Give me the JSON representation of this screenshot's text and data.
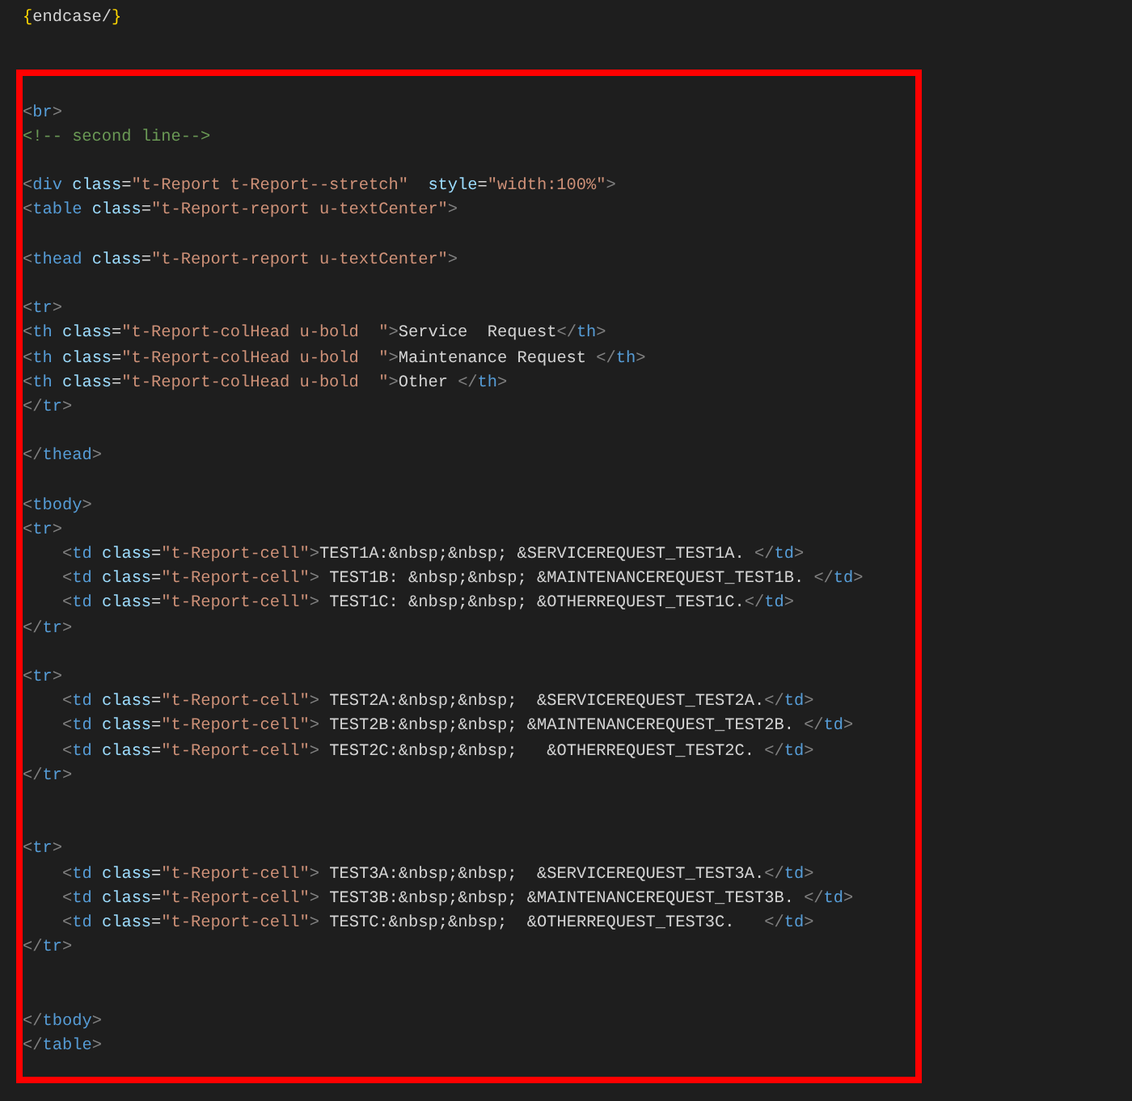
{
  "top_line": [
    {
      "kind": "brace",
      "text": "{"
    },
    {
      "kind": "text",
      "text": "endcase/"
    },
    {
      "kind": "brace",
      "text": "}"
    }
  ],
  "highlighted_code": {
    "lines": [
      {
        "kind": "code",
        "indented": false,
        "tokens": [
          {
            "kind": "punct",
            "text": "<"
          },
          {
            "kind": "tag",
            "text": "br"
          },
          {
            "kind": "punct",
            "text": ">"
          }
        ]
      },
      {
        "kind": "code",
        "indented": false,
        "tokens": [
          {
            "kind": "comment",
            "text": "<!-- second line-->"
          }
        ]
      },
      {
        "kind": "blank"
      },
      {
        "kind": "code",
        "indented": false,
        "tokens": [
          {
            "kind": "punct",
            "text": "<"
          },
          {
            "kind": "tag",
            "text": "div"
          },
          {
            "kind": "attr",
            "text": " class"
          },
          {
            "kind": "eq",
            "text": "="
          },
          {
            "kind": "string",
            "text": "\"t-Report t-Report--stretch\""
          },
          {
            "kind": "attr",
            "text": "  style"
          },
          {
            "kind": "eq",
            "text": "="
          },
          {
            "kind": "string",
            "text": "\"width:100%\""
          },
          {
            "kind": "punct",
            "text": ">"
          }
        ]
      },
      {
        "kind": "code",
        "indented": false,
        "tokens": [
          {
            "kind": "punct",
            "text": "<"
          },
          {
            "kind": "tag",
            "text": "table"
          },
          {
            "kind": "attr",
            "text": " class"
          },
          {
            "kind": "eq",
            "text": "="
          },
          {
            "kind": "string",
            "text": "\"t-Report-report u-textCenter\""
          },
          {
            "kind": "punct",
            "text": ">"
          }
        ]
      },
      {
        "kind": "blank"
      },
      {
        "kind": "code",
        "indented": false,
        "tokens": [
          {
            "kind": "punct",
            "text": "<"
          },
          {
            "kind": "tag",
            "text": "thead"
          },
          {
            "kind": "attr",
            "text": " class"
          },
          {
            "kind": "eq",
            "text": "="
          },
          {
            "kind": "string",
            "text": "\"t-Report-report u-textCenter\""
          },
          {
            "kind": "punct",
            "text": ">"
          }
        ]
      },
      {
        "kind": "blank"
      },
      {
        "kind": "code",
        "indented": false,
        "tokens": [
          {
            "kind": "punct",
            "text": "<"
          },
          {
            "kind": "tag",
            "text": "tr"
          },
          {
            "kind": "punct",
            "text": ">"
          }
        ]
      },
      {
        "kind": "code",
        "indented": false,
        "tokens": [
          {
            "kind": "punct",
            "text": "<"
          },
          {
            "kind": "tag",
            "text": "th"
          },
          {
            "kind": "attr",
            "text": " class"
          },
          {
            "kind": "eq",
            "text": "="
          },
          {
            "kind": "string",
            "text": "\"t-Report-colHead u-bold  \""
          },
          {
            "kind": "punct",
            "text": ">"
          },
          {
            "kind": "text",
            "text": "Service  Request"
          },
          {
            "kind": "punct",
            "text": "</"
          },
          {
            "kind": "tag",
            "text": "th"
          },
          {
            "kind": "punct",
            "text": ">"
          }
        ]
      },
      {
        "kind": "code",
        "indented": false,
        "tokens": [
          {
            "kind": "punct",
            "text": "<"
          },
          {
            "kind": "tag",
            "text": "th"
          },
          {
            "kind": "attr",
            "text": " class"
          },
          {
            "kind": "eq",
            "text": "="
          },
          {
            "kind": "string",
            "text": "\"t-Report-colHead u-bold  \""
          },
          {
            "kind": "punct",
            "text": ">"
          },
          {
            "kind": "text",
            "text": "Maintenance Request "
          },
          {
            "kind": "punct",
            "text": "</"
          },
          {
            "kind": "tag",
            "text": "th"
          },
          {
            "kind": "punct",
            "text": ">"
          }
        ]
      },
      {
        "kind": "code",
        "indented": false,
        "tokens": [
          {
            "kind": "punct",
            "text": "<"
          },
          {
            "kind": "tag",
            "text": "th"
          },
          {
            "kind": "attr",
            "text": " class"
          },
          {
            "kind": "eq",
            "text": "="
          },
          {
            "kind": "string",
            "text": "\"t-Report-colHead u-bold  \""
          },
          {
            "kind": "punct",
            "text": ">"
          },
          {
            "kind": "text",
            "text": "Other "
          },
          {
            "kind": "punct",
            "text": "</"
          },
          {
            "kind": "tag",
            "text": "th"
          },
          {
            "kind": "punct",
            "text": ">"
          }
        ]
      },
      {
        "kind": "code",
        "indented": false,
        "tokens": [
          {
            "kind": "punct",
            "text": "</"
          },
          {
            "kind": "tag",
            "text": "tr"
          },
          {
            "kind": "punct",
            "text": ">"
          }
        ]
      },
      {
        "kind": "blank"
      },
      {
        "kind": "code",
        "indented": false,
        "tokens": [
          {
            "kind": "punct",
            "text": "</"
          },
          {
            "kind": "tag",
            "text": "thead"
          },
          {
            "kind": "punct",
            "text": ">"
          }
        ]
      },
      {
        "kind": "blank"
      },
      {
        "kind": "code",
        "indented": false,
        "tokens": [
          {
            "kind": "punct",
            "text": "<"
          },
          {
            "kind": "tag",
            "text": "tbody"
          },
          {
            "kind": "punct",
            "text": ">"
          }
        ]
      },
      {
        "kind": "code",
        "indented": false,
        "tokens": [
          {
            "kind": "punct",
            "text": "<"
          },
          {
            "kind": "tag",
            "text": "tr"
          },
          {
            "kind": "punct",
            "text": ">"
          }
        ]
      },
      {
        "kind": "code",
        "indented": true,
        "tokens": [
          {
            "kind": "punct",
            "text": "<"
          },
          {
            "kind": "tag",
            "text": "td"
          },
          {
            "kind": "attr",
            "text": " class"
          },
          {
            "kind": "eq",
            "text": "="
          },
          {
            "kind": "string",
            "text": "\"t-Report-cell\""
          },
          {
            "kind": "punct",
            "text": ">"
          },
          {
            "kind": "text",
            "text": "TEST1A:&nbsp;&nbsp; &SERVICEREQUEST_TEST1A. "
          },
          {
            "kind": "punct",
            "text": "</"
          },
          {
            "kind": "tag",
            "text": "td"
          },
          {
            "kind": "punct",
            "text": ">"
          }
        ]
      },
      {
        "kind": "code",
        "indented": true,
        "tokens": [
          {
            "kind": "punct",
            "text": "<"
          },
          {
            "kind": "tag",
            "text": "td"
          },
          {
            "kind": "attr",
            "text": " class"
          },
          {
            "kind": "eq",
            "text": "="
          },
          {
            "kind": "string",
            "text": "\"t-Report-cell\""
          },
          {
            "kind": "punct",
            "text": ">"
          },
          {
            "kind": "text",
            "text": " TEST1B: &nbsp;&nbsp; &MAINTENANCEREQUEST_TEST1B. "
          },
          {
            "kind": "punct",
            "text": "</"
          },
          {
            "kind": "tag",
            "text": "td"
          },
          {
            "kind": "punct",
            "text": ">"
          }
        ]
      },
      {
        "kind": "code",
        "indented": true,
        "tokens": [
          {
            "kind": "punct",
            "text": "<"
          },
          {
            "kind": "tag",
            "text": "td"
          },
          {
            "kind": "attr",
            "text": " class"
          },
          {
            "kind": "eq",
            "text": "="
          },
          {
            "kind": "string",
            "text": "\"t-Report-cell\""
          },
          {
            "kind": "punct",
            "text": ">"
          },
          {
            "kind": "text",
            "text": " TEST1C: &nbsp;&nbsp; &OTHERREQUEST_TEST1C."
          },
          {
            "kind": "punct",
            "text": "</"
          },
          {
            "kind": "tag",
            "text": "td"
          },
          {
            "kind": "punct",
            "text": ">"
          }
        ]
      },
      {
        "kind": "code",
        "indented": false,
        "tokens": [
          {
            "kind": "punct",
            "text": "</"
          },
          {
            "kind": "tag",
            "text": "tr"
          },
          {
            "kind": "punct",
            "text": ">"
          }
        ]
      },
      {
        "kind": "blank"
      },
      {
        "kind": "code",
        "indented": false,
        "tokens": [
          {
            "kind": "punct",
            "text": "<"
          },
          {
            "kind": "tag",
            "text": "tr"
          },
          {
            "kind": "punct",
            "text": ">"
          }
        ]
      },
      {
        "kind": "code",
        "indented": true,
        "tokens": [
          {
            "kind": "punct",
            "text": "<"
          },
          {
            "kind": "tag",
            "text": "td"
          },
          {
            "kind": "attr",
            "text": " class"
          },
          {
            "kind": "eq",
            "text": "="
          },
          {
            "kind": "string",
            "text": "\"t-Report-cell\""
          },
          {
            "kind": "punct",
            "text": ">"
          },
          {
            "kind": "text",
            "text": " TEST2A:&nbsp;&nbsp;  &SERVICEREQUEST_TEST2A."
          },
          {
            "kind": "punct",
            "text": "</"
          },
          {
            "kind": "tag",
            "text": "td"
          },
          {
            "kind": "punct",
            "text": ">"
          }
        ]
      },
      {
        "kind": "code",
        "indented": true,
        "tokens": [
          {
            "kind": "punct",
            "text": "<"
          },
          {
            "kind": "tag",
            "text": "td"
          },
          {
            "kind": "attr",
            "text": " class"
          },
          {
            "kind": "eq",
            "text": "="
          },
          {
            "kind": "string",
            "text": "\"t-Report-cell\""
          },
          {
            "kind": "punct",
            "text": ">"
          },
          {
            "kind": "text",
            "text": " TEST2B:&nbsp;&nbsp; &MAINTENANCEREQUEST_TEST2B. "
          },
          {
            "kind": "punct",
            "text": "</"
          },
          {
            "kind": "tag",
            "text": "td"
          },
          {
            "kind": "punct",
            "text": ">"
          }
        ]
      },
      {
        "kind": "code",
        "indented": true,
        "tokens": [
          {
            "kind": "punct",
            "text": "<"
          },
          {
            "kind": "tag",
            "text": "td"
          },
          {
            "kind": "attr",
            "text": " class"
          },
          {
            "kind": "eq",
            "text": "="
          },
          {
            "kind": "string",
            "text": "\"t-Report-cell\""
          },
          {
            "kind": "punct",
            "text": ">"
          },
          {
            "kind": "text",
            "text": " TEST2C:&nbsp;&nbsp;   &OTHERREQUEST_TEST2C. "
          },
          {
            "kind": "punct",
            "text": "</"
          },
          {
            "kind": "tag",
            "text": "td"
          },
          {
            "kind": "punct",
            "text": ">"
          }
        ]
      },
      {
        "kind": "code",
        "indented": false,
        "tokens": [
          {
            "kind": "punct",
            "text": "</"
          },
          {
            "kind": "tag",
            "text": "tr"
          },
          {
            "kind": "punct",
            "text": ">"
          }
        ]
      },
      {
        "kind": "blank"
      },
      {
        "kind": "blank"
      },
      {
        "kind": "code",
        "indented": false,
        "tokens": [
          {
            "kind": "punct",
            "text": "<"
          },
          {
            "kind": "tag",
            "text": "tr"
          },
          {
            "kind": "punct",
            "text": ">"
          }
        ]
      },
      {
        "kind": "code",
        "indented": true,
        "tokens": [
          {
            "kind": "punct",
            "text": "<"
          },
          {
            "kind": "tag",
            "text": "td"
          },
          {
            "kind": "attr",
            "text": " class"
          },
          {
            "kind": "eq",
            "text": "="
          },
          {
            "kind": "string",
            "text": "\"t-Report-cell\""
          },
          {
            "kind": "punct",
            "text": ">"
          },
          {
            "kind": "text",
            "text": " TEST3A:&nbsp;&nbsp;  &SERVICEREQUEST_TEST3A."
          },
          {
            "kind": "punct",
            "text": "</"
          },
          {
            "kind": "tag",
            "text": "td"
          },
          {
            "kind": "punct",
            "text": ">"
          }
        ]
      },
      {
        "kind": "code",
        "indented": true,
        "tokens": [
          {
            "kind": "punct",
            "text": "<"
          },
          {
            "kind": "tag",
            "text": "td"
          },
          {
            "kind": "attr",
            "text": " class"
          },
          {
            "kind": "eq",
            "text": "="
          },
          {
            "kind": "string",
            "text": "\"t-Report-cell\""
          },
          {
            "kind": "punct",
            "text": ">"
          },
          {
            "kind": "text",
            "text": " TEST3B:&nbsp;&nbsp; &MAINTENANCEREQUEST_TEST3B. "
          },
          {
            "kind": "punct",
            "text": "</"
          },
          {
            "kind": "tag",
            "text": "td"
          },
          {
            "kind": "punct",
            "text": ">"
          }
        ]
      },
      {
        "kind": "code",
        "indented": true,
        "tokens": [
          {
            "kind": "punct",
            "text": "<"
          },
          {
            "kind": "tag",
            "text": "td"
          },
          {
            "kind": "attr",
            "text": " class"
          },
          {
            "kind": "eq",
            "text": "="
          },
          {
            "kind": "string",
            "text": "\"t-Report-cell\""
          },
          {
            "kind": "punct",
            "text": ">"
          },
          {
            "kind": "text",
            "text": " TESTC:&nbsp;&nbsp;  &OTHERREQUEST_TEST3C.   "
          },
          {
            "kind": "punct",
            "text": "</"
          },
          {
            "kind": "tag",
            "text": "td"
          },
          {
            "kind": "punct",
            "text": ">"
          }
        ]
      },
      {
        "kind": "code",
        "indented": false,
        "tokens": [
          {
            "kind": "punct",
            "text": "</"
          },
          {
            "kind": "tag",
            "text": "tr"
          },
          {
            "kind": "punct",
            "text": ">"
          }
        ]
      },
      {
        "kind": "blank"
      },
      {
        "kind": "blank"
      },
      {
        "kind": "code",
        "indented": false,
        "tokens": [
          {
            "kind": "punct",
            "text": "</"
          },
          {
            "kind": "tag",
            "text": "tbody"
          },
          {
            "kind": "punct",
            "text": ">"
          }
        ]
      },
      {
        "kind": "code",
        "indented": false,
        "tokens": [
          {
            "kind": "punct",
            "text": "</"
          },
          {
            "kind": "tag",
            "text": "table"
          },
          {
            "kind": "punct",
            "text": ">"
          }
        ]
      }
    ]
  }
}
